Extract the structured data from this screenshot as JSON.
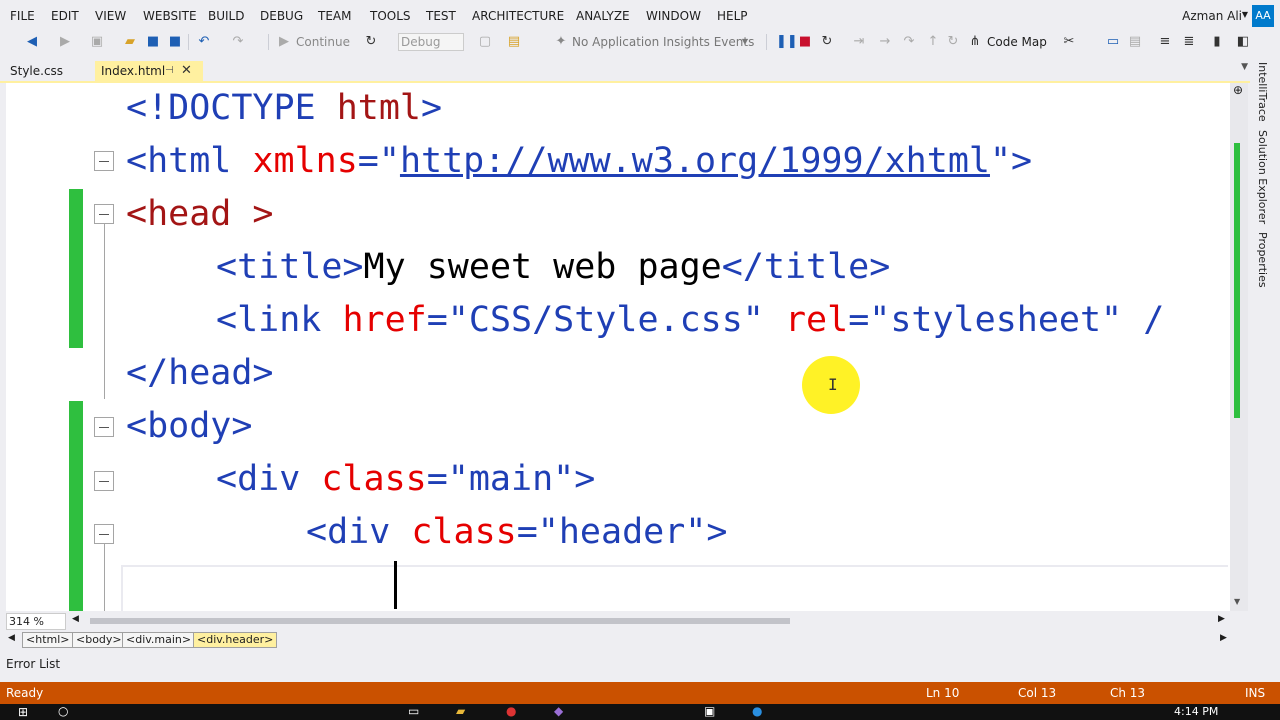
{
  "menu": {
    "items": [
      "FILE",
      "EDIT",
      "VIEW",
      "WEBSITE",
      "BUILD",
      "DEBUG",
      "TEAM",
      "TOOLS",
      "TEST",
      "ARCHITECTURE",
      "ANALYZE",
      "WINDOW",
      "HELP"
    ],
    "user_name": "Azman Ali",
    "user_initials": "AA"
  },
  "toolbar": {
    "continue_label": "Continue",
    "config_value": "Debug",
    "insights_label": "No Application Insights Events",
    "codemap_label": "Code Map"
  },
  "tabs": {
    "tab1": "Style.css",
    "tab2": "Index.html"
  },
  "code": {
    "l1_open": "<!DOCTYPE ",
    "l1_kw": "html",
    "l1_close": ">",
    "l2_open": "<html ",
    "l2_attr": "xmlns",
    "l2_eq": "=\"",
    "l2_url": "http://www.w3.org/1999/xhtml",
    "l2_close": "\">",
    "l3_open": "<head >",
    "l4_open": "<title>",
    "l4_text": "My sweet web page",
    "l4_close": "</title>",
    "l5_open": "<link ",
    "l5_attr1": "href",
    "l5_val1": "=\"CSS/Style.css\" ",
    "l5_attr2": "rel",
    "l5_val2": "=\"stylesheet\" /",
    "l6": "</head>",
    "l7": "<body>",
    "l8_open": "<div ",
    "l8_attr": "class",
    "l8_val": "=\"main\">",
    "l9_open": "<div ",
    "l9_attr": "class",
    "l9_val": "=\"header\">"
  },
  "zoom": "314 %",
  "breadcrumbs": [
    "<html>",
    "<body>",
    "<div.main>",
    "<div.header>"
  ],
  "error_list": "Error List",
  "status": {
    "ready": "Ready",
    "ln": "Ln 10",
    "col": "Col 13",
    "ch": "Ch 13",
    "ins": "INS"
  },
  "rail": [
    "IntelliTrace",
    "Solution Explorer",
    "Properties"
  ],
  "clock": "4:14 PM",
  "colors": {
    "accent": "#007acc",
    "status": "#ca5100",
    "changed": "#2fbf3f",
    "tab_active": "#fff0a0"
  }
}
